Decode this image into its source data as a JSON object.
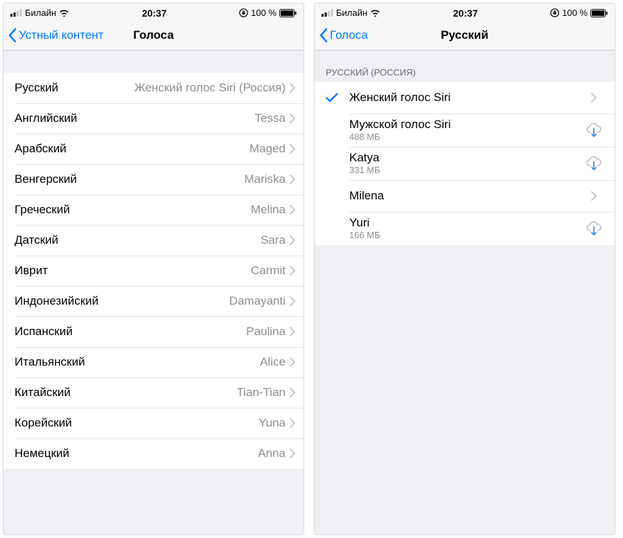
{
  "statusbar": {
    "carrier": "Билайн",
    "time": "20:37",
    "battery": "100 %"
  },
  "left_screen": {
    "back_label": "Устный контент",
    "title": "Голоса",
    "rows": [
      {
        "lang": "Русский",
        "voice": "Женский голос Siri (Россия)"
      },
      {
        "lang": "Английский",
        "voice": "Tessa"
      },
      {
        "lang": "Арабский",
        "voice": "Maged"
      },
      {
        "lang": "Венгерский",
        "voice": "Mariska"
      },
      {
        "lang": "Греческий",
        "voice": "Melina"
      },
      {
        "lang": "Датский",
        "voice": "Sara"
      },
      {
        "lang": "Иврит",
        "voice": "Carmit"
      },
      {
        "lang": "Индонезийский",
        "voice": "Damayanti"
      },
      {
        "lang": "Испанский",
        "voice": "Paulina"
      },
      {
        "lang": "Итальянский",
        "voice": "Alice"
      },
      {
        "lang": "Китайский",
        "voice": "Tian-Tian"
      },
      {
        "lang": "Корейский",
        "voice": "Yuna"
      },
      {
        "lang": "Немецкий",
        "voice": "Anna"
      }
    ]
  },
  "right_screen": {
    "back_label": "Голоса",
    "title": "Русский",
    "section_header": "РУССКИЙ (РОССИЯ)",
    "voices": [
      {
        "name": "Женский голос Siri",
        "size": "",
        "selected": true,
        "action": "chevron"
      },
      {
        "name": "Мужской голос Siri",
        "size": "488 МБ",
        "selected": false,
        "action": "download"
      },
      {
        "name": "Katya",
        "size": "331 МБ",
        "selected": false,
        "action": "download"
      },
      {
        "name": "Milena",
        "size": "",
        "selected": false,
        "action": "chevron"
      },
      {
        "name": "Yuri",
        "size": "166 МБ",
        "selected": false,
        "action": "download"
      }
    ]
  }
}
